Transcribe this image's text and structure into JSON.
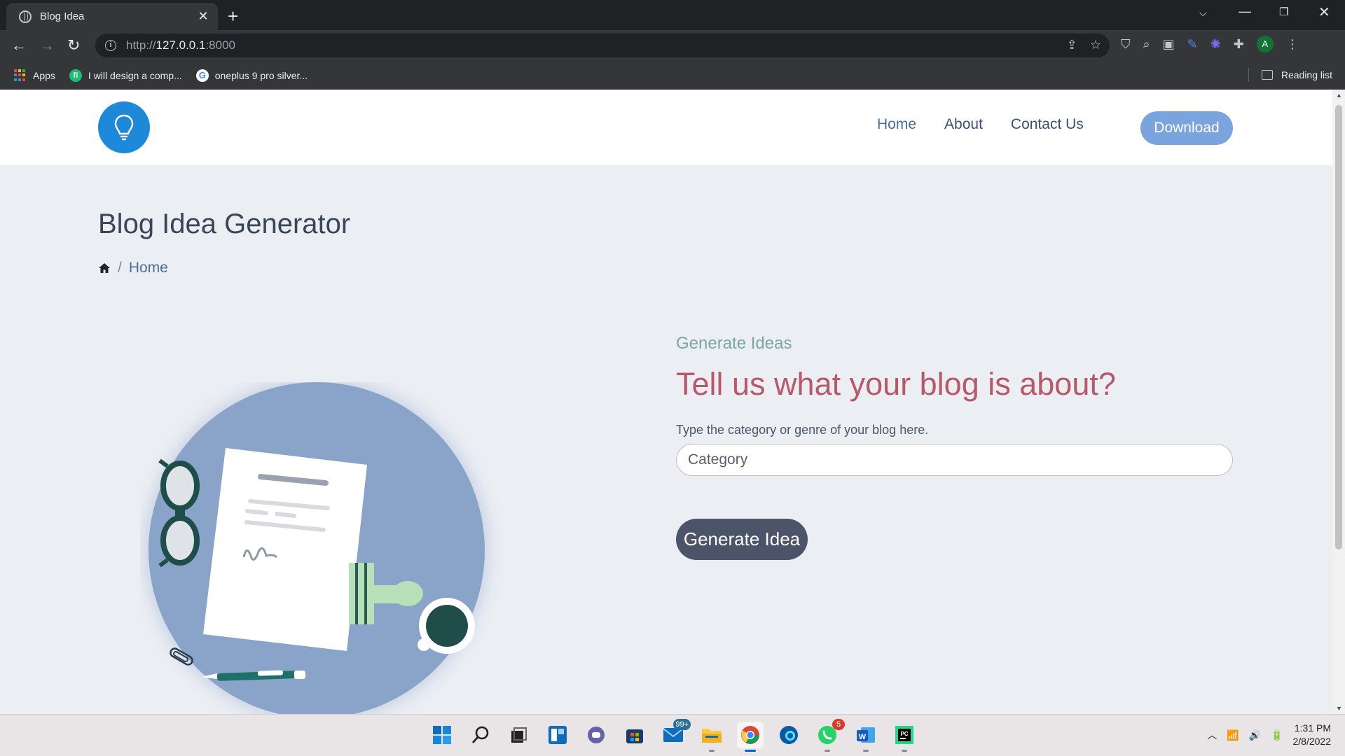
{
  "browser": {
    "tab_title": "Blog Idea",
    "url_protocol": "http://",
    "url_host": "127.0.0.1",
    "url_port": ":8000",
    "bookmarks": [
      {
        "label": "Apps",
        "icon": "apps-grid-icon"
      },
      {
        "label": "I will design a comp...",
        "icon": "fiverr-icon"
      },
      {
        "label": "oneplus 9 pro silver...",
        "icon": "google-icon"
      }
    ],
    "reading_list": "Reading list",
    "avatar_letter": "A"
  },
  "site": {
    "brand_color": "#1e88d9",
    "nav": [
      "Home",
      "About",
      "Contact Us"
    ],
    "download_label": "Download",
    "page_title": "Blog Idea Generator",
    "breadcrumb": "Home"
  },
  "form": {
    "eyebrow": "Generate Ideas",
    "headline": "Tell us what your blog is about?",
    "label": "Type the category or genre of your blog here.",
    "placeholder": "Category",
    "button": "Generate Idea"
  },
  "taskbar": {
    "mail_badge": "99+",
    "whatsapp_badge": "5",
    "time": "1:31 PM",
    "date": "2/8/2022"
  }
}
